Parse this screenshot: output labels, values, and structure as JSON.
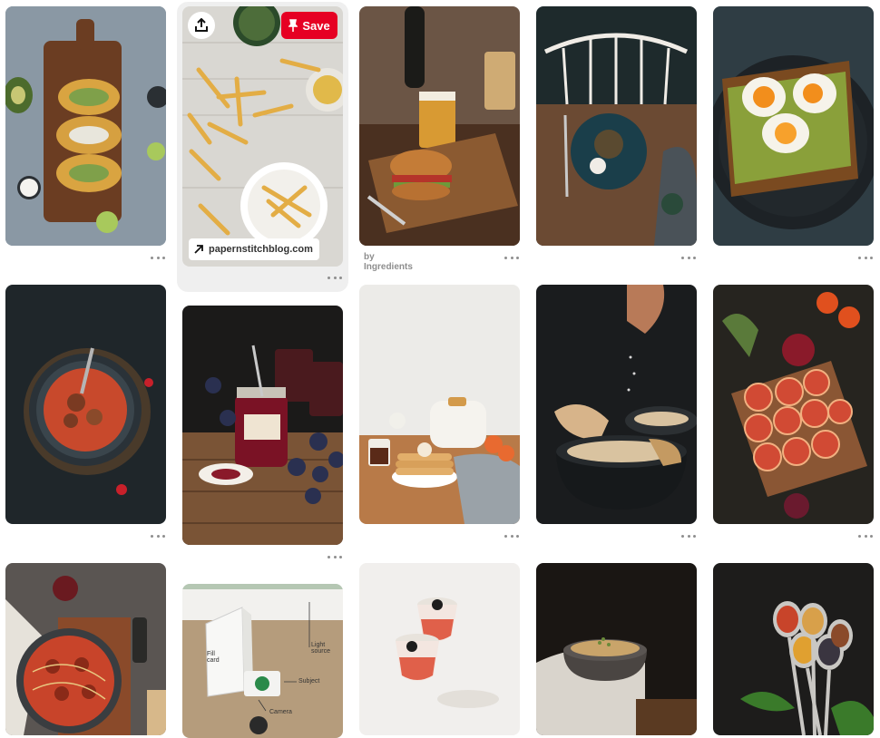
{
  "hovered_pin": {
    "save_label": "Save",
    "link_label": "papernstitchblog.com"
  },
  "attribution": "by Ingredients",
  "pins": [
    {
      "id": "tacos",
      "alt": "Avocado tacos on wooden board"
    },
    {
      "id": "fries",
      "alt": "French fries on newspaper"
    },
    {
      "id": "burger",
      "alt": "Burger with beer on wooden board"
    },
    {
      "id": "plate-chair",
      "alt": "Plated dish on table with chair"
    },
    {
      "id": "egg-toast",
      "alt": "Egg avocado toast"
    },
    {
      "id": "tomato-soup",
      "alt": "Tomato soup bowl"
    },
    {
      "id": "jam",
      "alt": "Jam jar with blueberries"
    },
    {
      "id": "pancakes",
      "alt": "Pancakes and teapot"
    },
    {
      "id": "soup-bread",
      "alt": "Soup with bread and salt"
    },
    {
      "id": "blood-orange",
      "alt": "Blood orange slices"
    },
    {
      "id": "spaghetti",
      "alt": "Spaghetti with meatballs"
    },
    {
      "id": "photo-setup",
      "alt": "Food photography setup diagram"
    },
    {
      "id": "drinks",
      "alt": "Cocktail glasses"
    },
    {
      "id": "porridge",
      "alt": "Porridge bowl"
    },
    {
      "id": "spices",
      "alt": "Spoons of spices"
    }
  ],
  "setup_labels": {
    "fill": "Fill\ncard",
    "light": "Light\nsource",
    "subject": "Subject",
    "camera": "Camera"
  }
}
